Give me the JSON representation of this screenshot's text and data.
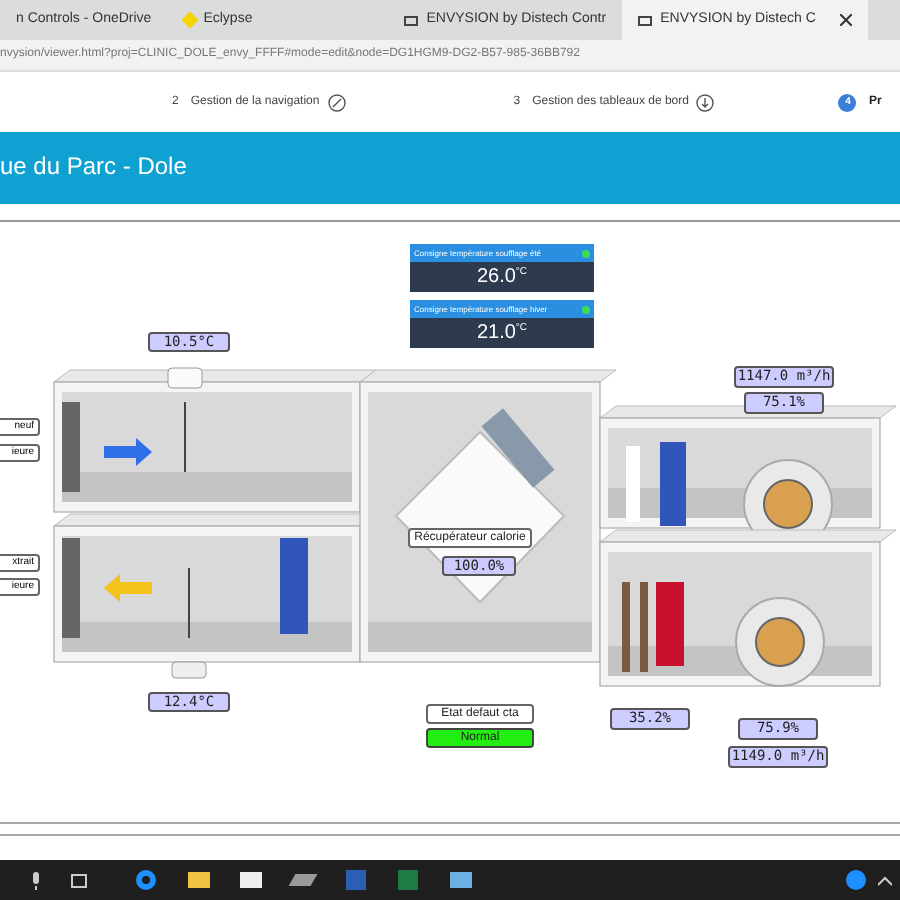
{
  "browser_tabs": [
    {
      "label": "n Controls - OneDrive",
      "selected": false
    },
    {
      "label": "Eclypse",
      "selected": false
    },
    {
      "label": "ENVYSION by Distech Contr",
      "selected": false
    },
    {
      "label": "ENVYSION by Distech C",
      "selected": true
    }
  ],
  "address_bar": {
    "value": "nvysion/viewer.html?proj=CLINIC_DOLE_envy_FFFF#mode=edit&node=DG1HGM9-DG2-B57-985-36BB792"
  },
  "steps": [
    {
      "number": "2",
      "label": "Gestion de la navigation",
      "selected": false
    },
    {
      "number": "3",
      "label": "Gestion des tableaux de bord",
      "selected": false
    },
    {
      "number": "4",
      "label": "Pr",
      "selected": true
    }
  ],
  "page_title": "ue du Parc - Dole",
  "setpoints": [
    {
      "label": "Consigne température soufflage été",
      "value": "26.0",
      "unit": "°C"
    },
    {
      "label": "Consigne température soufflage hiver",
      "value": "21.0",
      "unit": "°C"
    }
  ],
  "left_labels": [
    "neuf",
    "ieure",
    "xtrait",
    "ieure"
  ],
  "readings": {
    "fresh_air_temp": "10.5°C",
    "supply_flow": "1147.0 m³/h",
    "supply_fan": "75.1%",
    "recovery_label": "Récupérateur calorie",
    "recovery": "100.0%",
    "exhaust_temp": "12.4°C",
    "fault_label": "Etat defaut cta",
    "fault_status": "Normal",
    "heating": "35.2%",
    "exhaust_fan": "75.9%",
    "exhaust_flow": "1149.0 m³/h"
  }
}
